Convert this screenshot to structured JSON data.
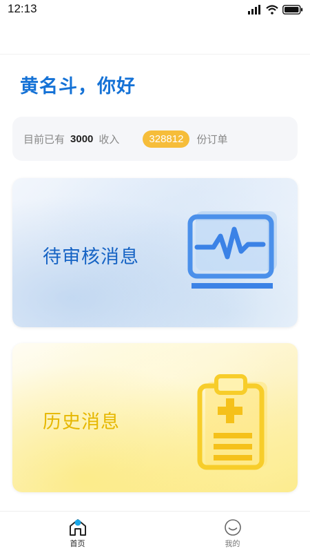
{
  "status_bar": {
    "time": "12:13",
    "icons": [
      "signal-icon",
      "wifi-icon",
      "battery-icon"
    ]
  },
  "greeting": "黄名斗，你好",
  "summary": {
    "prefix": "目前已有",
    "income_value": "3000",
    "income_label": "收入",
    "order_count": "328812",
    "order_label": "份订单"
  },
  "cards": [
    {
      "title": "待审核消息",
      "icon": "monitor-pulse-icon",
      "color": "#1663c4"
    },
    {
      "title": "历史消息",
      "icon": "clipboard-medical-icon",
      "color": "#e6b700"
    }
  ],
  "tabs": [
    {
      "label": "首页",
      "icon": "home-icon",
      "active": true
    },
    {
      "label": "我的",
      "icon": "smiley-icon",
      "active": false
    }
  ],
  "colors": {
    "accent": "#1572d6",
    "badge": "#f6bd3a",
    "active_dot": "#1aa7e8"
  }
}
